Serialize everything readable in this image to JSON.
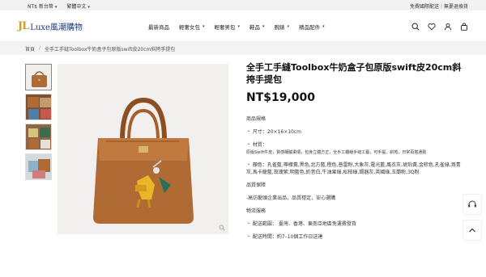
{
  "topbar": {
    "currency": "NT$ 新台幣",
    "language": "繁體中文",
    "promo": "免費國際配送｜無憂退換貨"
  },
  "header": {
    "logo_mark_a": "J",
    "logo_mark_b": "L",
    "logo_name": "Luxe風潮購物",
    "nav": [
      {
        "label": "最新商品",
        "has_caret": false
      },
      {
        "label": "輕奢女包",
        "has_caret": true
      },
      {
        "label": "輕奢男包",
        "has_caret": true
      },
      {
        "label": "鞋品",
        "has_caret": true
      },
      {
        "label": "腕錶",
        "has_caret": true
      },
      {
        "label": "精品配件",
        "has_caret": true
      }
    ],
    "icons": [
      "search-icon",
      "heart-icon",
      "user-icon",
      "bag-icon"
    ]
  },
  "breadcrumb": {
    "home": "首頁",
    "current": "全手工手縫Toolbox牛奶盒子包原版swift皮20cm斜挎手提包"
  },
  "product": {
    "title": "全手工手縫Toolbox牛奶盒子包原版swift皮20cm斜挎手提包",
    "price": "NT$19,000",
    "spec_heading": "商品規格",
    "size": "・ 尺寸：20×16×10cm",
    "material_label": "・ 材質：",
    "material_text": "原版Swift牛皮，質感細膩柔順，包身立體方正，全手工蠟線手縫工藝，可手提、斜挎，日常百搭通勤",
    "colors": "・ 顏色：孔雀藍,檸檬黃,黑色,北方藍,橙色,普雷粉,大象灰,電光藍,風衣灰,琥珀黃,金棕色,孔雀綠,溉青灰,馬卡龍藍,玫瑰紫,明藍色,奶昔白,牛油果綠,松柏綠,錫器灰,英國綠,玉蘭粉,3Q粉",
    "quality_heading": "品質保障",
    "quality_text": "-高仿龍頭企業出品，品質穩定，安心選購",
    "shipping_heading": "物流服務",
    "ship_range": "・ 配送範圍： 臺灣、香港、東南亞地區免運費發貨",
    "ship_time": "・ 配送時間：約7–10個工作日送達"
  },
  "colors": {
    "accent": "#1e3a7a",
    "gold": "#c9a227",
    "leather": "#b06a33"
  }
}
